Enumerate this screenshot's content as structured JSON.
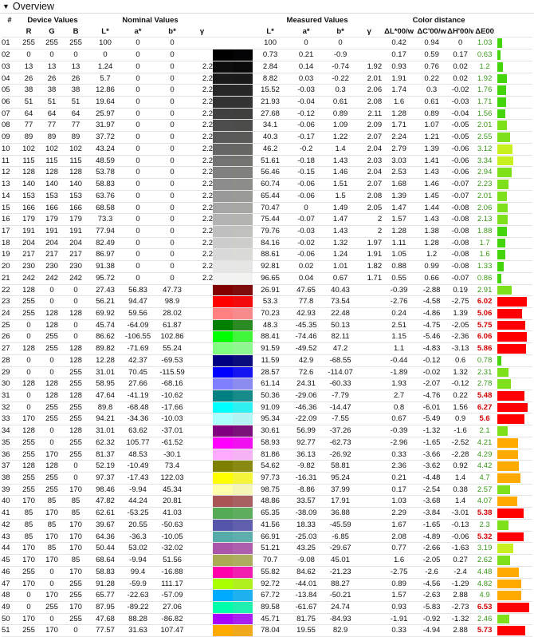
{
  "section_title": "Overview",
  "group_headers": {
    "index": "#",
    "device": "Device Values",
    "nominal": "Nominal Values",
    "measured": "Measured Values",
    "distance": "Color distance"
  },
  "columns": [
    "R",
    "G",
    "B",
    "L*",
    "a*",
    "b*",
    "γ",
    "L*",
    "a*",
    "b*",
    "γ",
    "ΔL*00/w",
    "ΔC'00/w",
    "ΔH'00/w",
    "ΔE00"
  ],
  "rows": [
    [
      "01",
      "255",
      "255",
      "255",
      "100",
      "0",
      "0",
      "",
      "100",
      "0",
      "0",
      "",
      "0.42",
      "0.94",
      "0",
      "1.03"
    ],
    [
      "02",
      "0",
      "0",
      "0",
      "0",
      "0",
      "0",
      "",
      "0.73",
      "0.21",
      "-0.9",
      "",
      "0.17",
      "0.59",
      "0.17",
      "0.63"
    ],
    [
      "03",
      "13",
      "13",
      "13",
      "1.24",
      "0",
      "0",
      "2.2",
      "2.84",
      "0.14",
      "-0.74",
      "1.92",
      "0.93",
      "0.76",
      "0.02",
      "1.2"
    ],
    [
      "04",
      "26",
      "26",
      "26",
      "5.7",
      "0",
      "0",
      "2.2",
      "8.82",
      "0.03",
      "-0.22",
      "2.01",
      "1.91",
      "0.22",
      "0.02",
      "1.92"
    ],
    [
      "05",
      "38",
      "38",
      "38",
      "12.86",
      "0",
      "0",
      "2.2",
      "15.52",
      "-0.03",
      "0.3",
      "2.06",
      "1.74",
      "0.3",
      "-0.02",
      "1.76"
    ],
    [
      "06",
      "51",
      "51",
      "51",
      "19.64",
      "0",
      "0",
      "2.2",
      "21.93",
      "-0.04",
      "0.61",
      "2.08",
      "1.6",
      "0.61",
      "-0.03",
      "1.71"
    ],
    [
      "07",
      "64",
      "64",
      "64",
      "25.97",
      "0",
      "0",
      "2.2",
      "27.68",
      "-0.12",
      "0.89",
      "2.11",
      "1.28",
      "0.89",
      "-0.04",
      "1.56"
    ],
    [
      "08",
      "77",
      "77",
      "77",
      "31.97",
      "0",
      "0",
      "2.2",
      "34.1",
      "-0.06",
      "1.09",
      "2.09",
      "1.71",
      "1.07",
      "-0.05",
      "2.01"
    ],
    [
      "09",
      "89",
      "89",
      "89",
      "37.72",
      "0",
      "0",
      "2.2",
      "40.3",
      "-0.17",
      "1.22",
      "2.07",
      "2.24",
      "1.21",
      "-0.05",
      "2.55"
    ],
    [
      "10",
      "102",
      "102",
      "102",
      "43.24",
      "0",
      "0",
      "2.2",
      "46.2",
      "-0.2",
      "1.4",
      "2.04",
      "2.79",
      "1.39",
      "-0.06",
      "3.12"
    ],
    [
      "11",
      "115",
      "115",
      "115",
      "48.59",
      "0",
      "0",
      "2.2",
      "51.61",
      "-0.18",
      "1.43",
      "2.03",
      "3.03",
      "1.41",
      "-0.06",
      "3.34"
    ],
    [
      "12",
      "128",
      "128",
      "128",
      "53.78",
      "0",
      "0",
      "2.2",
      "56.46",
      "-0.15",
      "1.46",
      "2.04",
      "2.53",
      "1.43",
      "-0.06",
      "2.94"
    ],
    [
      "13",
      "140",
      "140",
      "140",
      "58.83",
      "0",
      "0",
      "2.2",
      "60.74",
      "-0.06",
      "1.51",
      "2.07",
      "1.68",
      "1.46",
      "-0.07",
      "2.23"
    ],
    [
      "14",
      "153",
      "153",
      "153",
      "63.76",
      "0",
      "0",
      "2.2",
      "65.44",
      "-0.06",
      "1.5",
      "2.08",
      "1.39",
      "1.45",
      "-0.07",
      "2.01"
    ],
    [
      "15",
      "166",
      "166",
      "166",
      "68.58",
      "0",
      "0",
      "2.2",
      "70.47",
      "0",
      "1.49",
      "2.05",
      "1.47",
      "1.44",
      "-0.08",
      "2.06"
    ],
    [
      "16",
      "179",
      "179",
      "179",
      "73.3",
      "0",
      "0",
      "2.2",
      "75.44",
      "-0.07",
      "1.47",
      "2",
      "1.57",
      "1.43",
      "-0.08",
      "2.13"
    ],
    [
      "17",
      "191",
      "191",
      "191",
      "77.94",
      "0",
      "0",
      "2.2",
      "79.76",
      "-0.03",
      "1.43",
      "2",
      "1.28",
      "1.38",
      "-0.08",
      "1.88"
    ],
    [
      "18",
      "204",
      "204",
      "204",
      "82.49",
      "0",
      "0",
      "2.2",
      "84.16",
      "-0.02",
      "1.32",
      "1.97",
      "1.11",
      "1.28",
      "-0.08",
      "1.7"
    ],
    [
      "19",
      "217",
      "217",
      "217",
      "86.97",
      "0",
      "0",
      "2.2",
      "88.61",
      "-0.06",
      "1.24",
      "1.91",
      "1.05",
      "1.2",
      "-0.08",
      "1.6"
    ],
    [
      "20",
      "230",
      "230",
      "230",
      "91.38",
      "0",
      "0",
      "2.2",
      "92.81",
      "0.02",
      "1.01",
      "1.82",
      "0.88",
      "0.99",
      "-0.08",
      "1.33"
    ],
    [
      "21",
      "242",
      "242",
      "242",
      "95.72",
      "0",
      "0",
      "2.2",
      "96.65",
      "0.04",
      "0.67",
      "1.71",
      "0.55",
      "0.66",
      "-0.07",
      "0.86"
    ],
    [
      "22",
      "128",
      "0",
      "0",
      "27.43",
      "56.83",
      "47.73",
      "",
      "26.91",
      "47.65",
      "40.43",
      "",
      "-0.39",
      "-2.88",
      "0.19",
      "2.91"
    ],
    [
      "23",
      "255",
      "0",
      "0",
      "56.21",
      "94.47",
      "98.9",
      "",
      "53.3",
      "77.8",
      "73.54",
      "",
      "-2.76",
      "-4.58",
      "-2.75",
      "6.02"
    ],
    [
      "24",
      "255",
      "128",
      "128",
      "69.92",
      "59.56",
      "28.02",
      "",
      "70.23",
      "42.93",
      "22.48",
      "",
      "0.24",
      "-4.86",
      "1.39",
      "5.06"
    ],
    [
      "25",
      "0",
      "128",
      "0",
      "45.74",
      "-64.09",
      "61.87",
      "",
      "48.3",
      "-45.35",
      "50.13",
      "",
      "2.51",
      "-4.75",
      "-2.05",
      "5.75"
    ],
    [
      "26",
      "0",
      "255",
      "0",
      "86.62",
      "-106.55",
      "102.86",
      "",
      "88.41",
      "-74.46",
      "82.11",
      "",
      "1.15",
      "-5.46",
      "-2.36",
      "6.06"
    ],
    [
      "27",
      "128",
      "255",
      "128",
      "89.82",
      "-71.69",
      "55.24",
      "",
      "91.59",
      "-49.52",
      "47.2",
      "",
      "1.1",
      "-4.83",
      "-3.13",
      "5.86"
    ],
    [
      "28",
      "0",
      "0",
      "128",
      "12.28",
      "42.37",
      "-69.53",
      "",
      "11.59",
      "42.9",
      "-68.55",
      "",
      "-0.44",
      "-0.12",
      "0.6",
      "0.78"
    ],
    [
      "29",
      "0",
      "0",
      "255",
      "31.01",
      "70.45",
      "-115.59",
      "",
      "28.57",
      "72.6",
      "-114.07",
      "",
      "-1.89",
      "-0.02",
      "1.32",
      "2.31"
    ],
    [
      "30",
      "128",
      "128",
      "255",
      "58.95",
      "27.66",
      "-68.16",
      "",
      "61.14",
      "24.31",
      "-60.33",
      "",
      "1.93",
      "-2.07",
      "-0.12",
      "2.78"
    ],
    [
      "31",
      "0",
      "128",
      "128",
      "47.64",
      "-41.19",
      "-10.62",
      "",
      "50.36",
      "-29.06",
      "-7.79",
      "",
      "2.7",
      "-4.76",
      "0.22",
      "5.48"
    ],
    [
      "32",
      "0",
      "255",
      "255",
      "89.8",
      "-68.48",
      "-17.66",
      "",
      "91.09",
      "-46.36",
      "-14.47",
      "",
      "0.8",
      "-6.01",
      "1.56",
      "6.27"
    ],
    [
      "33",
      "170",
      "255",
      "255",
      "94.21",
      "-34.36",
      "-10.03",
      "",
      "95.34",
      "-22.09",
      "-7.55",
      "",
      "0.67",
      "-5.49",
      "0.9",
      "5.6"
    ],
    [
      "34",
      "128",
      "0",
      "128",
      "31.01",
      "63.62",
      "-37.01",
      "",
      "30.61",
      "56.99",
      "-37.26",
      "",
      "-0.39",
      "-1.32",
      "-1.6",
      "2.1"
    ],
    [
      "35",
      "255",
      "0",
      "255",
      "62.32",
      "105.77",
      "-61.52",
      "",
      "58.93",
      "92.77",
      "-62.73",
      "",
      "-2.96",
      "-1.65",
      "-2.52",
      "4.21"
    ],
    [
      "36",
      "255",
      "170",
      "255",
      "81.37",
      "48.53",
      "-30.1",
      "",
      "81.86",
      "36.13",
      "-26.92",
      "",
      "0.33",
      "-3.66",
      "-2.28",
      "4.29"
    ],
    [
      "37",
      "128",
      "128",
      "0",
      "52.19",
      "-10.49",
      "73.4",
      "",
      "54.62",
      "-9.82",
      "58.81",
      "",
      "2.36",
      "-3.62",
      "0.92",
      "4.42"
    ],
    [
      "38",
      "255",
      "255",
      "0",
      "97.37",
      "-17.43",
      "122.03",
      "",
      "97.73",
      "-16.31",
      "95.24",
      "",
      "0.21",
      "-4.48",
      "1.4",
      "4.7"
    ],
    [
      "39",
      "255",
      "255",
      "170",
      "98.46",
      "-9.94",
      "45.34",
      "",
      "98.75",
      "-8.86",
      "37.99",
      "",
      "0.17",
      "-2.54",
      "0.38",
      "2.57"
    ],
    [
      "40",
      "170",
      "85",
      "85",
      "47.82",
      "44.24",
      "20.81",
      "",
      "48.86",
      "33.57",
      "17.91",
      "",
      "1.03",
      "-3.68",
      "1.4",
      "4.07"
    ],
    [
      "41",
      "85",
      "170",
      "85",
      "62.61",
      "-53.25",
      "41.03",
      "",
      "65.35",
      "-38.09",
      "36.88",
      "",
      "2.29",
      "-3.84",
      "-3.01",
      "5.38"
    ],
    [
      "42",
      "85",
      "85",
      "170",
      "39.67",
      "20.55",
      "-50.63",
      "",
      "41.56",
      "18.33",
      "-45.59",
      "",
      "1.67",
      "-1.65",
      "-0.13",
      "2.3"
    ],
    [
      "43",
      "85",
      "170",
      "170",
      "64.36",
      "-36.3",
      "-10.05",
      "",
      "66.91",
      "-25.03",
      "-6.85",
      "",
      "2.08",
      "-4.89",
      "-0.06",
      "5.32"
    ],
    [
      "44",
      "170",
      "85",
      "170",
      "50.44",
      "53.02",
      "-32.02",
      "",
      "51.21",
      "43.25",
      "-29.67",
      "",
      "0.77",
      "-2.66",
      "-1.63",
      "3.19"
    ],
    [
      "45",
      "170",
      "170",
      "85",
      "68.64",
      "-9.94",
      "51.56",
      "",
      "70.7",
      "-9.08",
      "45.01",
      "",
      "1.6",
      "-2.05",
      "0.27",
      "2.62"
    ],
    [
      "46",
      "255",
      "0",
      "170",
      "58.83",
      "99.4",
      "-16.88",
      "",
      "55.82",
      "84.62",
      "-21.23",
      "",
      "-2.75",
      "-2.6",
      "-2.4",
      "4.48"
    ],
    [
      "47",
      "170",
      "0",
      "255",
      "91.28",
      "-59.9",
      "111.17",
      "",
      "92.72",
      "-44.01",
      "88.27",
      "",
      "0.89",
      "-4.56",
      "-1.29",
      "4.82"
    ],
    [
      "48",
      "0",
      "170",
      "255",
      "65.77",
      "-22.63",
      "-57.09",
      "",
      "67.72",
      "-13.84",
      "-50.21",
      "",
      "1.57",
      "-2.63",
      "2.88",
      "4.9"
    ],
    [
      "49",
      "0",
      "255",
      "170",
      "87.95",
      "-89.22",
      "27.06",
      "",
      "89.58",
      "-61.67",
      "24.74",
      "",
      "0.93",
      "-5.83",
      "-2.73",
      "6.53"
    ],
    [
      "50",
      "170",
      "0",
      "255",
      "47.68",
      "88.28",
      "-86.82",
      "",
      "45.71",
      "81.75",
      "-84.93",
      "",
      "-1.91",
      "-0.92",
      "-1.32",
      "2.46"
    ],
    [
      "51",
      "255",
      "170",
      "0",
      "77.57",
      "31.63",
      "107.47",
      "",
      "78.04",
      "19.55",
      "82.9",
      "",
      "0.33",
      "-4.94",
      "2.88",
      "5.73"
    ]
  ],
  "nominal_swatches": [
    "#ffffff",
    "#000000",
    "#0d0d0d",
    "#1a1a1a",
    "#262626",
    "#333333",
    "#404040",
    "#4d4d4d",
    "#595959",
    "#666666",
    "#737373",
    "#808080",
    "#8c8c8c",
    "#999999",
    "#a6a6a6",
    "#b3b3b3",
    "#bfbfbf",
    "#cccccc",
    "#d9d9d9",
    "#e6e6e6",
    "#f2f2f2",
    "#800000",
    "#ff0000",
    "#ff8080",
    "#008000",
    "#00ff00",
    "#80ff80",
    "#000080",
    "#0000ff",
    "#8080ff",
    "#008080",
    "#00ffff",
    "#aaffff",
    "#800080",
    "#ff00ff",
    "#ffaaff",
    "#808000",
    "#ffff00",
    "#ffffaa",
    "#aa5555",
    "#55aa55",
    "#5555aa",
    "#55aaaa",
    "#aa55aa",
    "#aaaa55",
    "#ff00aa",
    "#aaff00",
    "#00aaff",
    "#00ffaa",
    "#aa00ff",
    "#ffaa00"
  ],
  "measured_swatches": [
    "#ffffff",
    "#040406",
    "#090909",
    "#191919",
    "#262626",
    "#333333",
    "#3f3f3e",
    "#4c4c4a",
    "#595957",
    "#666663",
    "#737370",
    "#80807d",
    "#8d8d8a",
    "#9a9a97",
    "#a6a6a3",
    "#b3b3b0",
    "#c0c0bd",
    "#cdcdca",
    "#dadad7",
    "#e6e6e4",
    "#f2f2f1",
    "#7e0c0c",
    "#f30a0a",
    "#f78a8a",
    "#2c8a22",
    "#41f53a",
    "#8ff78f",
    "#0b0b7e",
    "#1414f0",
    "#8c8cf0",
    "#178a8a",
    "#2ff0f0",
    "#b3f5f5",
    "#7a107a",
    "#f010f0",
    "#f5b3f5",
    "#8a8a12",
    "#f5f53a",
    "#f5f5b8",
    "#a86060",
    "#5fad5f",
    "#5f5fad",
    "#5fadad",
    "#ad5fad",
    "#adad5f",
    "#f01fb0",
    "#b0f01f",
    "#1fb0f0",
    "#1ff0b0",
    "#a81ff0",
    "#f0a81f"
  ]
}
